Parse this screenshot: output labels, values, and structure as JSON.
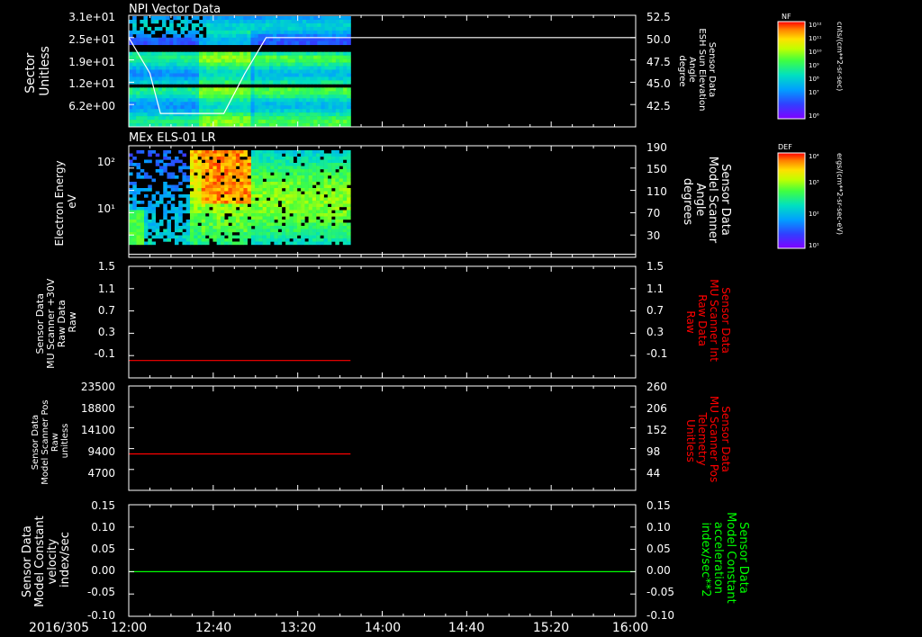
{
  "date_label": "2016/305",
  "x_ticks": [
    "12:00",
    "12:40",
    "13:20",
    "14:00",
    "14:40",
    "15:20",
    "16:00"
  ],
  "colors": {
    "background": "#000000",
    "axis": "#ffffff",
    "red_trace": "#ff0000",
    "green_trace": "#00ff00",
    "white_trace": "#ffffff"
  },
  "colorbars": [
    {
      "tag": "NF",
      "units": "cnts/(cm**2-sr-sec)",
      "top_label": "10¹²",
      "mid_labels": [
        "10¹¹",
        "10¹⁰",
        "10⁹",
        "10⁸",
        "10⁷"
      ],
      "bottom_label": "10⁶"
    },
    {
      "tag": "DEF",
      "units": "ergs/(cm**2-sr-sec-eV)",
      "top_label": "10⁴",
      "mid_labels": [
        "10³",
        "10²"
      ],
      "bottom_label": "10¹"
    }
  ],
  "chart_data": [
    {
      "type": "heatmap",
      "title": "NPI Vector Data",
      "ylabel": [
        "Sector",
        "Unitless"
      ],
      "y_ticks": [
        "3.1e+01",
        "2.5e+01",
        "1.9e+01",
        "1.2e+01",
        "6.2e+00"
      ],
      "right_ylabel": [
        "Sensor Data",
        "ESH Sun Elevation",
        "Angle",
        "degree"
      ],
      "right_y_ticks": [
        "52.5",
        "50.0",
        "47.5",
        "45.0",
        "42.5"
      ],
      "right_ylim": [
        40.0,
        52.5
      ],
      "overlay_line": {
        "name": "ESH Sun Elevation Angle",
        "x": [
          "12:00",
          "12:10",
          "12:15",
          "12:30",
          "12:45",
          "12:55",
          "13:05",
          "13:45"
        ],
        "y": [
          50.0,
          46.0,
          41.5,
          41.5,
          41.5,
          46.0,
          50.0,
          50.0
        ]
      },
      "data_x_range": [
        "12:00",
        "13:45"
      ]
    },
    {
      "type": "heatmap",
      "title": "MEx ELS-01 LR",
      "ylabel": [
        "Electron Energy",
        "eV"
      ],
      "y_ticks": [
        "10²",
        "10¹"
      ],
      "y_scale": "log",
      "right_ylabel": [
        "Sensor Data",
        "Model Scanner",
        "Angle",
        "degrees"
      ],
      "right_y_ticks": [
        "190",
        "150",
        "110",
        "70",
        "30"
      ],
      "right_ylim": [
        0,
        190
      ],
      "overlay_line": {
        "name": "Model Scanner Angle",
        "x": [
          "12:00",
          "16:00"
        ],
        "y": [
          5,
          5
        ]
      },
      "data_x_range": [
        "12:00",
        "13:45"
      ]
    },
    {
      "type": "line",
      "ylabel": [
        "Sensor Data",
        "MU Scanner +30V",
        "Raw Data",
        "Raw"
      ],
      "y_ticks": [
        "1.5",
        "1.1",
        "0.7",
        "0.3",
        "-0.1"
      ],
      "ylim": [
        -0.3,
        1.5
      ],
      "right_ylabel": [
        "Sensor Data",
        "MU Scanner Int",
        "Raw Data",
        "Raw"
      ],
      "right_y_ticks": [
        "1.5",
        "1.1",
        "0.7",
        "0.3",
        "-0.1"
      ],
      "series": [
        {
          "color": "#ff0000",
          "x": [
            "12:00",
            "13:45"
          ],
          "y": [
            -0.02,
            -0.02
          ]
        }
      ]
    },
    {
      "type": "line",
      "ylabel": [
        "Sensor Data",
        "Model Scanner Pos",
        "Raw",
        "unitless"
      ],
      "y_ticks": [
        "23500",
        "18800",
        "14100",
        "9400",
        "4700"
      ],
      "ylim": [
        0,
        23500
      ],
      "right_ylabel": [
        "Sensor Data",
        "MU Scanner Pos",
        "Telemetry",
        "Unitless"
      ],
      "right_y_ticks": [
        "260",
        "206",
        "152",
        "98",
        "44"
      ],
      "series": [
        {
          "color": "#ff0000",
          "x": [
            "12:00",
            "13:45"
          ],
          "y": [
            8200,
            8200
          ]
        }
      ]
    },
    {
      "type": "line",
      "ylabel": [
        "Sensor Data",
        "Model Constant",
        "velocity",
        "index/sec"
      ],
      "y_ticks": [
        "0.15",
        "0.10",
        "0.05",
        "0.00",
        "-0.05",
        "-0.10"
      ],
      "ylim": [
        -0.1,
        0.15
      ],
      "right_ylabel": [
        "Sensor Data",
        "Model Constant",
        "acceleration",
        "index/sec**2"
      ],
      "right_y_ticks": [
        "0.15",
        "0.10",
        "0.05",
        "0.00",
        "-0.05",
        "-0.10"
      ],
      "series": [
        {
          "color": "#00ff00",
          "x": [
            "12:00",
            "16:00"
          ],
          "y": [
            0.0,
            0.0
          ]
        }
      ]
    }
  ]
}
